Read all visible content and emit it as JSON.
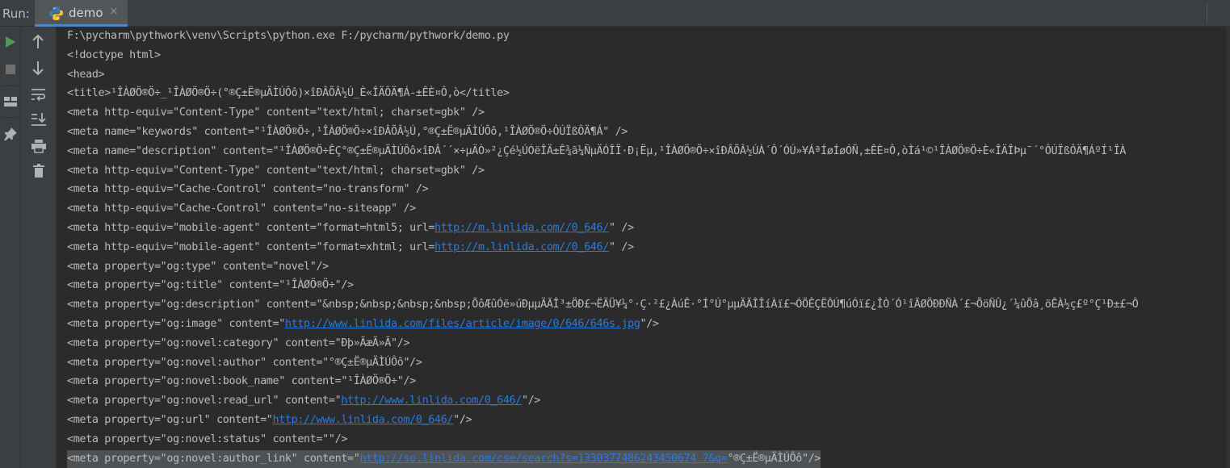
{
  "header": {
    "run_label": "Run:",
    "tab": {
      "label": "demo",
      "close": "×",
      "icon": "python-icon"
    }
  },
  "sidebar_left": {
    "items": [
      {
        "name": "run-icon",
        "color": "#499c54"
      },
      {
        "name": "stop-icon",
        "color": "#6e6e6e"
      },
      {
        "name": "layout-icon"
      },
      {
        "name": "pin-icon"
      }
    ]
  },
  "sidebar_tools": {
    "items": [
      {
        "name": "up-arrow-icon"
      },
      {
        "name": "down-arrow-icon"
      },
      {
        "name": "soft-wrap-icon"
      },
      {
        "name": "scroll-to-end-icon"
      },
      {
        "name": "print-icon"
      },
      {
        "name": "trash-icon"
      }
    ]
  },
  "colors": {
    "text": "#bbbbbb",
    "link": "#287bde",
    "background": "#2b2b2b",
    "panel": "#3c3f41"
  },
  "console": {
    "lines": [
      {
        "parts": [
          {
            "t": "F:\\pycharm\\pythwork\\venv\\Scripts\\python.exe F:/pycharm/pythwork/demo.py"
          }
        ]
      },
      {
        "parts": [
          {
            "t": "<!doctype html>"
          }
        ]
      },
      {
        "parts": [
          {
            "t": "<head>"
          }
        ]
      },
      {
        "parts": [
          {
            "t": "<title>¹ÎÀØÖ®Ö÷_¹ÎÀØÖ®Ö÷(°®Ç±Ë®µÄÌÚÔô)×îÐÂÕÂ½Ú_È«ÎÄÔÄ¶Á-±ÊÈ¤Ô,ò</title>"
          }
        ]
      },
      {
        "parts": [
          {
            "t": "<meta http-equiv=\"Content-Type\" content=\"text/html; charset=gbk\" />"
          }
        ]
      },
      {
        "parts": [
          {
            "t": "<meta name=\"keywords\" content=\"¹ÎÀØÖ®Ö÷,¹ÎÀØÖ®Ö÷×îÐÂÕÂ½Ú,°®Ç±Ë®µÄÌÚÔô,¹ÎÀØÖ®Ö÷ÔÚÏßÔÄ¶Á\" />"
          }
        ]
      },
      {
        "parts": [
          {
            "t": "<meta name=\"description\" content=\"¹ÎÀØÖ®Ö÷ÊÇ°®Ç±Ë®µÄÌÚÔô×îÐÂ´´×÷µÄÒ»²¿Çé½ÚÓëÎÄ±Ê¾ã¼ÑµÄÓÎÏ·Ð¡Ëµ,¹ÎÀØÖ®Ö÷×îÐÂÕÂ½ÚÀ´Ô´ÓÚ»¥ÁªÍøÍøÓÑ,±ÊÈ¤Ô,òÌá¹©¹ÎÀØÖ®Ö÷È«ÎÄÎÞµ¯´°ÔÚÏßÔÄ¶ÁºÍ¹ÎÀ"
          }
        ]
      },
      {
        "parts": [
          {
            "t": "<meta http-equiv=\"Content-Type\" content=\"text/html; charset=gbk\" />"
          }
        ]
      },
      {
        "parts": [
          {
            "t": "<meta http-equiv=\"Cache-Control\" content=\"no-transform\" />"
          }
        ]
      },
      {
        "parts": [
          {
            "t": "<meta http-equiv=\"Cache-Control\" content=\"no-siteapp\" />"
          }
        ]
      },
      {
        "parts": [
          {
            "t": "<meta http-equiv=\"mobile-agent\" content=\"format=html5; url="
          },
          {
            "t": "http://m.linlida.com//0_646/",
            "link": true
          },
          {
            "t": "\" />"
          }
        ]
      },
      {
        "parts": [
          {
            "t": "<meta http-equiv=\"mobile-agent\" content=\"format=xhtml; url="
          },
          {
            "t": "http://m.linlida.com//0_646/",
            "link": true
          },
          {
            "t": "\" />"
          }
        ]
      },
      {
        "parts": [
          {
            "t": "<meta property=\"og:type\" content=\"novel\"/>"
          }
        ]
      },
      {
        "parts": [
          {
            "t": "<meta property=\"og:title\" content=\"¹ÎÀØÖ®Ö÷\"/>"
          }
        ]
      },
      {
        "parts": [
          {
            "t": "<meta property=\"og:description\" content=\"&nbsp;&nbsp;&nbsp;&nbsp;ÕôÆûÓë»úÐµµÄÃÎ³±ÖÐ£¬Ë­ÄÜ¥¼°·Ç·²£¿ÀúÊ·°Í°Ú°µµÄÃÎÎíÀï£¬ÓÖÊÇË­ÔÚ¶úÓï£¿ÎÒ´Ó¹îÃØÖÐÐÑÀ´£¬ÕöÑÛ¿´¼ûÕâ¸öÊÀ½ç£º°Ç¹Ð±£¬Ô"
          }
        ]
      },
      {
        "parts": [
          {
            "t": "<meta property=\"og:image\" content=\""
          },
          {
            "t": "http://www.linlida.com/files/article/image/0/646/646s.jpg",
            "link": true
          },
          {
            "t": "\"/>"
          }
        ]
      },
      {
        "parts": [
          {
            "t": "<meta property=\"og:novel:category\" content=\"Ðþ»ÃæÃ»Ã\"/>"
          }
        ]
      },
      {
        "parts": [
          {
            "t": "<meta property=\"og:novel:author\" content=\"°®Ç±Ë®µÄÌÚÔô\"/>"
          }
        ]
      },
      {
        "parts": [
          {
            "t": "<meta property=\"og:novel:book_name\" content=\"¹ÎÀØÖ®Ö÷\"/>"
          }
        ]
      },
      {
        "parts": [
          {
            "t": "<meta property=\"og:novel:read_url\" content=\""
          },
          {
            "t": "http://www.linlida.com/0_646/",
            "link": true
          },
          {
            "t": "\"/>"
          }
        ]
      },
      {
        "parts": [
          {
            "t": "<meta property=\"og:url\" content=\""
          },
          {
            "t": "http://www.linlida.com/0_646/",
            "link": true
          },
          {
            "t": "\"/>"
          }
        ]
      },
      {
        "parts": [
          {
            "t": "<meta property=\"og:novel:status\" content=\"\"/>"
          }
        ]
      },
      {
        "parts": [
          {
            "t": "<meta property=\"og:novel:author_link\" content=\""
          },
          {
            "t": "http://so.linlida.com/cse/search?s=1330377486243450674 7&q=",
            "link": true
          },
          {
            "t": "°®Ç±Ë®µÄÌÚÔô\"/>"
          }
        ],
        "selected": true
      }
    ]
  }
}
